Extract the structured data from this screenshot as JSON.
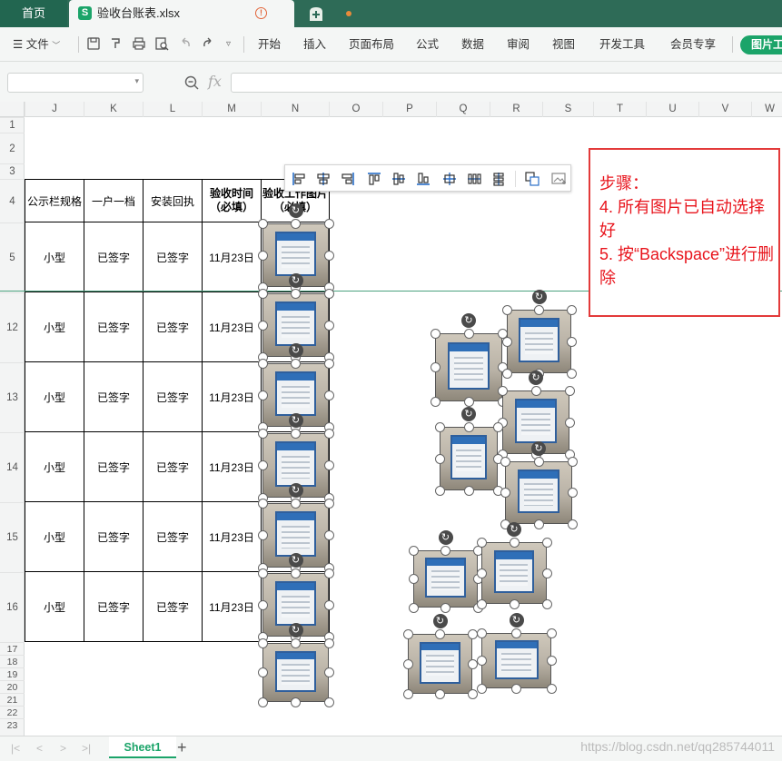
{
  "tabs": {
    "home": "首页",
    "file": "验收台账表.xlsx"
  },
  "ribbon": {
    "file_menu": "文件",
    "tabs": [
      "开始",
      "插入",
      "页面布局",
      "公式",
      "数据",
      "审阅",
      "视图",
      "开发工具",
      "会员专享"
    ],
    "picture_tool": "图片工"
  },
  "formula_bar": {
    "fx": "fx"
  },
  "columns": [
    "J",
    "K",
    "L",
    "M",
    "N",
    "O",
    "P",
    "Q",
    "R",
    "S",
    "T",
    "U",
    "V",
    "W"
  ],
  "rows": [
    "1",
    "2",
    "3",
    "4",
    "5",
    "12",
    "13",
    "14",
    "15",
    "16",
    "17",
    "18",
    "19",
    "20",
    "21",
    "22",
    "23"
  ],
  "table": {
    "headers": [
      "公示栏规格",
      "一户一档",
      "安装回执",
      "验收时间\n（必填）",
      "验收工作图片（必填）"
    ],
    "rows": [
      [
        "小型",
        "已签字",
        "已签字",
        "11月23日"
      ],
      [
        "小型",
        "已签字",
        "已签字",
        "11月23日"
      ],
      [
        "小型",
        "已签字",
        "已签字",
        "11月23日"
      ],
      [
        "小型",
        "已签字",
        "已签字",
        "11月23日"
      ],
      [
        "小型",
        "已签字",
        "已签字",
        "11月23日"
      ],
      [
        "小型",
        "已签字",
        "已签字",
        "11月23日"
      ]
    ]
  },
  "callout": {
    "line1": "步骤：",
    "line2": "4. 所有图片已自动选择好",
    "line3": "5. 按“Backspace”进行删除"
  },
  "sheets": {
    "active": "Sheet1"
  },
  "watermark": "https://blog.csdn.net/qq285744011",
  "colors": {
    "accent": "#1ba469",
    "tabbar": "#2e6b57",
    "callout_red": "#e8141c"
  }
}
